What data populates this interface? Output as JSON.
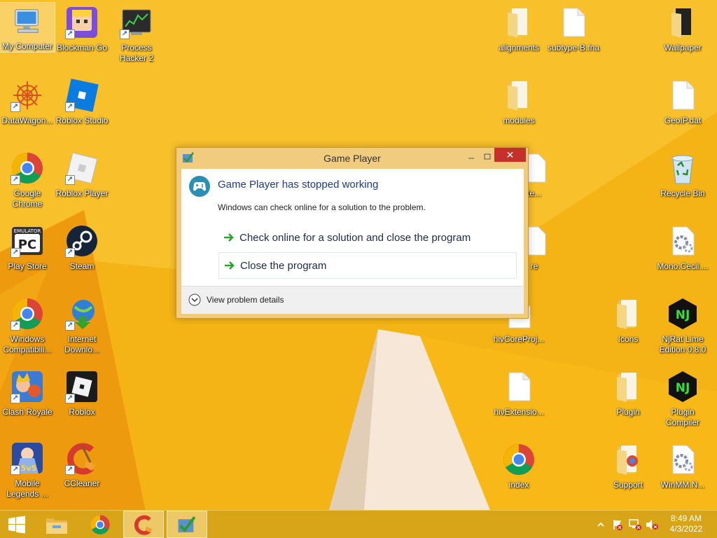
{
  "desktop": {
    "icons": {
      "my_computer": "My Computer",
      "blockman_go": "Blockman Go",
      "process_hacker": "Process Hacker 2",
      "datawagon": "DataWagon...",
      "roblox_studio": "Roblox Studio",
      "google_chrome": "Google Chrome",
      "roblox_player": "Roblox Player",
      "play_store": "Play Store",
      "steam": "Steam",
      "windows_compat": "Windows Compatibili...",
      "internet_download": "Internet Downlo...",
      "clash_royale": "Clash Royale",
      "roblox": "Roblox",
      "mobile_legends": "Mobile Legends ...",
      "ccleaner": "CCleaner",
      "alignments": "alignments",
      "subtype": "subtype-B.fna",
      "wallpaper": "Wallpaper",
      "modules": "modules",
      "geoip": "GeoIP.dat",
      "hidden_te": "te...",
      "recycle_bin": "Recycle Bin",
      "hidden_re": "re",
      "mono_cecil": "Mono.Cecil....",
      "hiv_core": "hivCoreProj...",
      "icons_folder": "Icons",
      "njrat": "NjRat Lime Edition 0.8.0",
      "hiv_extension": "hivExtensio...",
      "plugin": "Plugin",
      "plugin_compiler": "Plugin Compiler",
      "index": "index",
      "support": "Support",
      "winmm": "WinMM.N..."
    },
    "emulator_badge": "EMULATOR",
    "pc_text": "PC",
    "nj_text": "NJ",
    "ml_badge": "5v5"
  },
  "dialog": {
    "title": "Game Player",
    "heading": "Game Player has stopped working",
    "subtext": "Windows can check online for a solution to the problem.",
    "option_check": "Check online for a solution and close the program",
    "option_close": "Close the program",
    "details": "View problem details",
    "close_glyph": "✕"
  },
  "taskbar": {
    "time": "8:49 AM",
    "date": "4/3/2022"
  },
  "colors": {
    "wallpaper": "#f5b416",
    "taskbar": "#d6a418",
    "dialog_frame": "#f2cc7e",
    "close_button": "#c7302a",
    "heading": "#1c3a8a"
  }
}
